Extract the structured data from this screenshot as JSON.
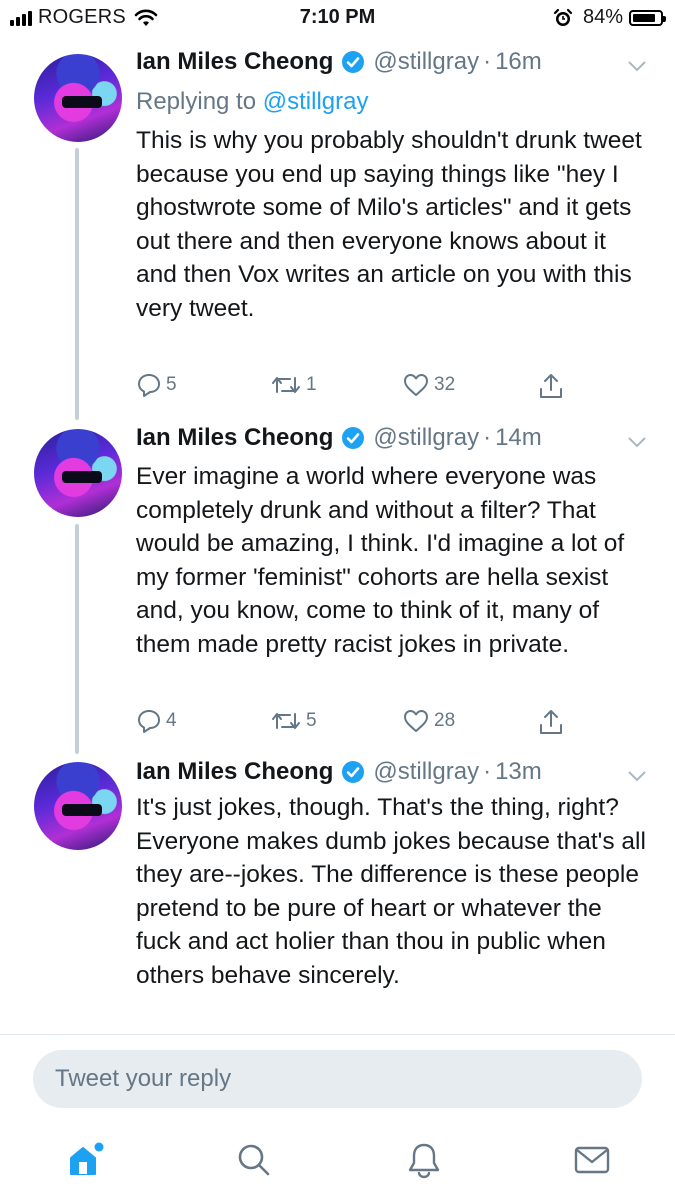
{
  "status_bar": {
    "carrier": "ROGERS",
    "time": "7:10 PM",
    "battery": "84%",
    "battery_level": 0.84,
    "icons": [
      "signal-icon",
      "wifi-icon",
      "alarm-icon",
      "battery-icon"
    ]
  },
  "tweets": [
    {
      "name": "Ian Miles Cheong",
      "handle": "@stillgray",
      "dot": "·",
      "time": "16m",
      "replying_prefix": "Replying to",
      "replying_to": "@stillgray",
      "text": "This is why you probably shouldn't drunk tweet because you end up saying things like \"hey I ghostwrote some of Milo's articles\" and it gets out there and then everyone knows about it and then Vox writes an article on you with this very tweet.",
      "replies": "5",
      "retweets": "1",
      "likes": "32"
    },
    {
      "name": "Ian Miles Cheong",
      "handle": "@stillgray",
      "dot": "·",
      "time": "14m",
      "text": "Ever imagine a world where everyone was completely drunk and without a filter? That would be amazing, I think. I'd imagine a lot of my former 'feminist\" cohorts are hella sexist and, you know, come to think of it, many of them made pretty racist jokes in private.",
      "replies": "4",
      "retweets": "5",
      "likes": "28"
    },
    {
      "name": "Ian Miles Cheong",
      "handle": "@stillgray",
      "dot": "·",
      "time": "13m",
      "text": "It's just jokes, though. That's the thing, right? Everyone makes dumb jokes because that's all they are--jokes. The difference is these people pretend to be pure of heart or whatever the fuck and act holier than thou in public when others behave sincerely."
    }
  ],
  "reply_box": {
    "placeholder": "Tweet your reply"
  },
  "tab_bar": [
    "home-icon",
    "search-icon",
    "notifications-icon",
    "messages-icon"
  ],
  "colors": {
    "accent": "#1da1f2",
    "muted": "#657786",
    "thread_line": "#c4cfd6"
  }
}
